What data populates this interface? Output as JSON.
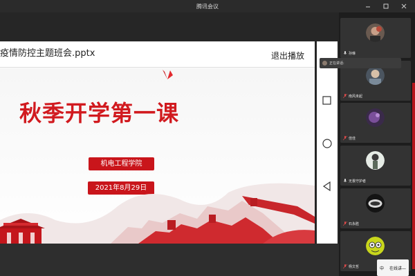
{
  "window": {
    "title": "腾讯会议",
    "controls": [
      "minimize",
      "maximize",
      "close"
    ]
  },
  "slide": {
    "filename": "疫情防控主题班会.pptx",
    "exit_label": "退出播放",
    "main_title": "秋季开学第一课",
    "school": "机电工程学院",
    "date": "2021年8月29日"
  },
  "side_controls": [
    "square-icon",
    "circle-icon",
    "back-triangle-icon"
  ],
  "speaking": {
    "label": "正在讲话:"
  },
  "participants": [
    {
      "name": "孙琳"
    },
    {
      "name": "南风未起"
    },
    {
      "name": "佳佳"
    },
    {
      "name": "无畏守护者"
    },
    {
      "name": "石永胜"
    },
    {
      "name": "杨文哲"
    }
  ],
  "chat": {
    "left": "中",
    "right": "在线讲—"
  },
  "colors": {
    "accent_red": "#d11a1f",
    "pill_red": "#c9151b",
    "panel_bg": "#1d1d1d",
    "tile_bg": "#333333"
  }
}
